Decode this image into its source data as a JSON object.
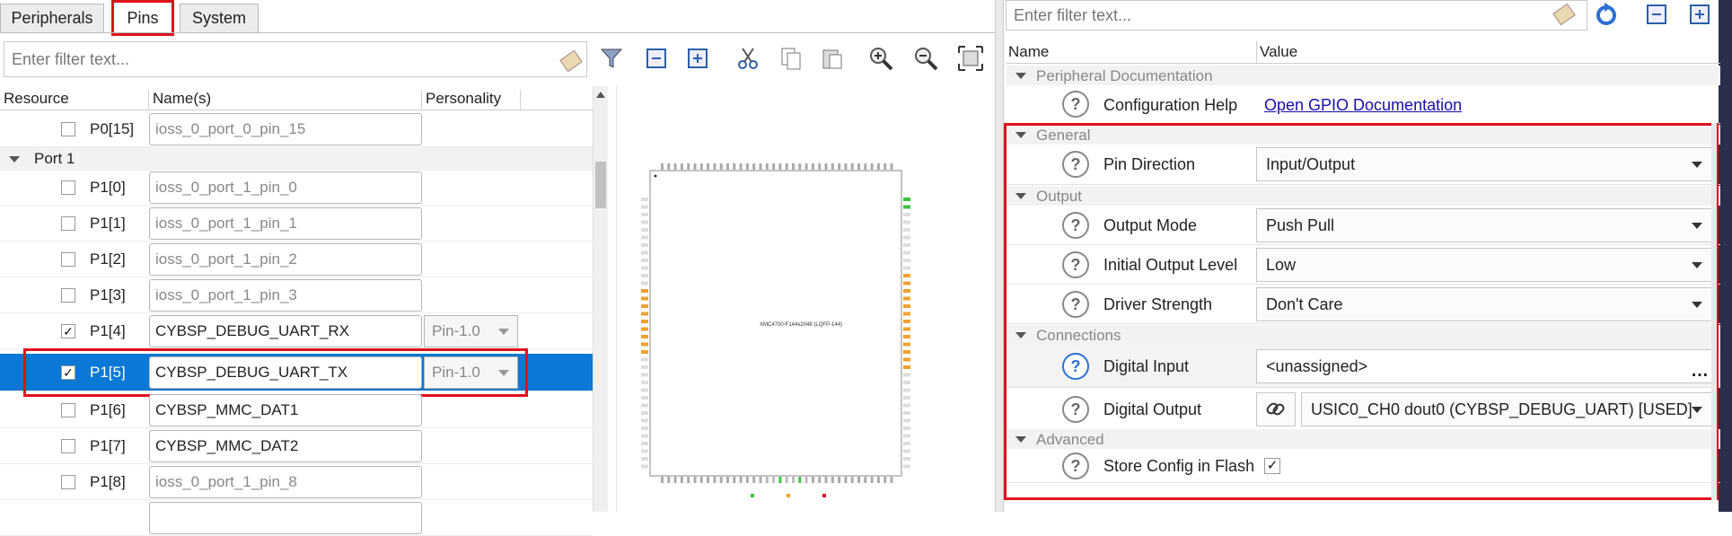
{
  "left_tabs": [
    "Peripherals",
    "Pins",
    "System"
  ],
  "left_filter_placeholder": "Enter filter text...",
  "columns": {
    "resource": "Resource",
    "names": "Name(s)",
    "personality": "Personality"
  },
  "port_group": "Port 1",
  "rows": [
    {
      "resource": "P0[15]",
      "name": "ioss_0_port_0_pin_15",
      "checked": false,
      "personality": ""
    },
    {
      "resource": "P1[0]",
      "name": "ioss_0_port_1_pin_0",
      "checked": false,
      "personality": ""
    },
    {
      "resource": "P1[1]",
      "name": "ioss_0_port_1_pin_1",
      "checked": false,
      "personality": ""
    },
    {
      "resource": "P1[2]",
      "name": "ioss_0_port_1_pin_2",
      "checked": false,
      "personality": ""
    },
    {
      "resource": "P1[3]",
      "name": "ioss_0_port_1_pin_3",
      "checked": false,
      "personality": ""
    },
    {
      "resource": "P1[4]",
      "name": "CYBSP_DEBUG_UART_RX",
      "checked": true,
      "personality": "Pin-1.0"
    },
    {
      "resource": "P1[5]",
      "name": "CYBSP_DEBUG_UART_TX",
      "checked": true,
      "personality": "Pin-1.0"
    },
    {
      "resource": "P1[6]",
      "name": "CYBSP_MMC_DAT1",
      "checked": false,
      "personality": ""
    },
    {
      "resource": "P1[7]",
      "name": "CYBSP_MMC_DAT2",
      "checked": false,
      "personality": ""
    },
    {
      "resource": "P1[8]",
      "name": "ioss_0_port_1_pin_8",
      "checked": false,
      "personality": ""
    }
  ],
  "chip_label": "XMC4700-F144x2048 (LQFP-144)",
  "right_filter_placeholder": "Enter filter text...",
  "prop_columns": {
    "name": "Name",
    "value": "Value"
  },
  "sections": {
    "peripheral_doc": "Peripheral Documentation",
    "general": "General",
    "output": "Output",
    "connections": "Connections",
    "advanced": "Advanced"
  },
  "props": {
    "config_help": {
      "label": "Configuration Help",
      "value": "Open GPIO Documentation"
    },
    "pin_direction": {
      "label": "Pin Direction",
      "value": "Input/Output"
    },
    "output_mode": {
      "label": "Output Mode",
      "value": "Push Pull"
    },
    "initial_output_level": {
      "label": "Initial Output Level",
      "value": "Low"
    },
    "driver_strength": {
      "label": "Driver Strength",
      "value": "Don't Care"
    },
    "digital_input": {
      "label": "Digital Input",
      "value": "<unassigned>"
    },
    "digital_output": {
      "label": "Digital Output",
      "value": "USIC0_CH0 dout0 (CYBSP_DEBUG_UART) [USED]"
    },
    "store_config": {
      "label": "Store Config in Flash",
      "checked": true
    }
  },
  "colors": {
    "selection": "#0a78d4",
    "highlight_red": "#e0101c",
    "link": "#1a0dab",
    "pin_orange": "#f0a030",
    "pin_green": "#3cc43c"
  },
  "icons": [
    "eraser-icon",
    "filter-icon",
    "collapse-icon",
    "expand-icon",
    "cut-icon",
    "copy-icon",
    "paste-icon",
    "zoom-in-icon",
    "zoom-out-icon",
    "fit-icon",
    "refresh-icon",
    "help-icon",
    "link-icon"
  ]
}
